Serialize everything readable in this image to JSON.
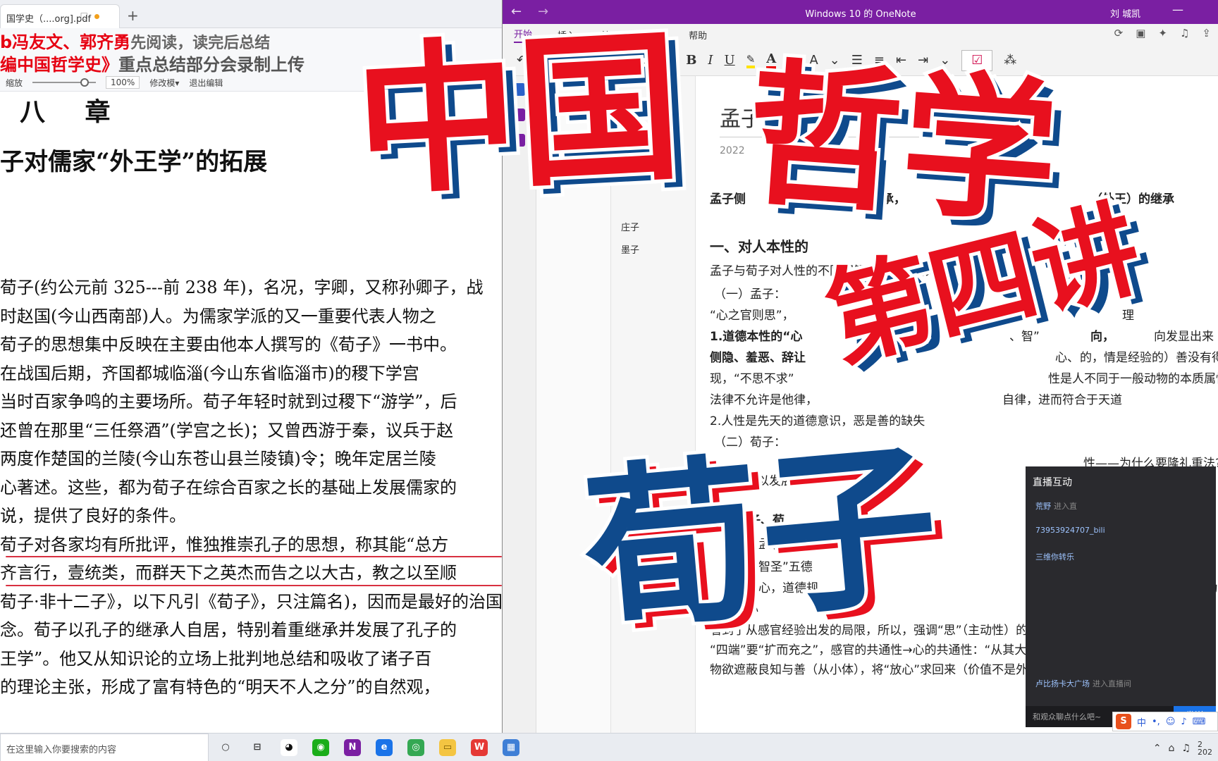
{
  "pdf": {
    "tab_label": "国学史（....org].pdf",
    "tab_close": "□",
    "newtab_icon": "+",
    "overlay_line1_red": "b冯友文",
    "overlay_line1_mid": "、郭齐勇",
    "overlay_line1_rest": "先阅读，读完后总结",
    "overlay_line2_red": "编中国哲学史》",
    "overlay_line2_rest": "重点总结部分会录制上传",
    "toolbar": {
      "zoom_label": "缩放",
      "zoom_value": "100%",
      "zoom_level": 0.75,
      "mode_label": "修改模▾",
      "exit_label": "退出编辑"
    },
    "chapter_heading": "八 章",
    "section_title": "子对儒家“外王学”的拓展",
    "body_lines": [
      "  荀子(约公元前 325---前 238 年)，名况，字卿，又称孙卿子，战",
      "时赵国(今山西南部)人。为儒家学派的又一重要代表人物之",
      "  荀子的思想集中反映在主要由他本人撰写的《荀子》一书中。",
      "  在战国后期，齐国都城临淄(今山东省临淄市)的稷下学宫",
      "当时百家争鸣的主要场所。荀子年轻时就到过稷下“游学”，后",
      "还曾在那里“三任祭酒”(学宫之长)；又曾西游于秦，议兵于赵",
      "两度作楚国的兰陵(今山东苍山县兰陵镇)令；晚年定居兰陵",
      "心著述。这些，都为荀子在综合百家之长的基础上发展儒家的",
      "说，提供了良好的条件。",
      "  荀子对各家均有所批评，惟独推崇孔子的思想，称其能“总方",
      "齐言行，壹统类，而群天下之英杰而告之以大古，教之以至顺",
      "荀子·非十二子》，以下凡引《荀子》，只注篇名)，因而是最好的治国",
      "念。荀子以孔子的继承人自居，特别着重继承并发展了孔子的",
      "王学”。他又从知识论的立场上批判地总结和吸收了诸子百",
      "的理论主张，形成了富有特色的“明天不人之分”的自然观，"
    ],
    "underlined_lines": [
      9,
      10
    ]
  },
  "onenote": {
    "app_title": "Windows 10 的 OneNote",
    "user_name": "刘 城凯",
    "nav_back": "←",
    "nav_forward": "→",
    "ribbon_tabs": [
      "开始",
      "插入",
      "绘图",
      "视图",
      "帮助"
    ],
    "font_name": "等线 YaH",
    "font_size": "11",
    "format_labels": {
      "bold": "B",
      "italic": "I",
      "underline": "U",
      "font_color": "A",
      "style": "A"
    },
    "sidebar_accents": [
      "#2a62c9",
      "#7a1fa2",
      "#7a1fa2"
    ],
    "pages": [
      "庄子",
      "墨子"
    ],
    "page_title": "孟子",
    "page_date": "2022",
    "content_lines": [
      {
        "text": "孟子侧",
        "bold": true
      },
      {
        "text": "的继承，",
        "bold": true
      },
      {
        "text": "（外王）的继承",
        "bold": true
      },
      {
        "text": "一、对人本性的",
        "bold": true,
        "size": 20
      },
      {
        "text": "孟子与荀子对人性的不同理解，仁来自何处",
        "bold": false
      },
      {
        "text": "（一）孟子：",
        "bold": false
      },
      {
        "text": "“心之官则思”，",
        "bold": false
      },
      {
        "text": "感官的",
        "bold": false
      },
      {
        "text": "理",
        "bold": false
      },
      {
        "text": "1.道德本性的“心",
        "bold": true,
        "blue_part": "1."
      },
      {
        "text": "、智”",
        "bold": false
      },
      {
        "text": "向，",
        "bold": true
      },
      {
        "text": "向发显出来",
        "bold": false
      },
      {
        "text": "侧隐、羞恶、辞让",
        "bold": true
      },
      {
        "text": "心、",
        "bold": false
      },
      {
        "text": "的，情是经验的）善没有得到恰当",
        "bold": false
      },
      {
        "text": "现，“不思不求”",
        "bold": false
      },
      {
        "text": "性是人不同于一般动物的本质属性",
        "bold": false
      },
      {
        "text": "法律不允许是他律，",
        "bold": false
      },
      {
        "text": "自律，进而符合于天道",
        "bold": false
      },
      {
        "text": "2.人性是先天的道德意识，恶是善的缺失",
        "bold": false
      },
      {
        "text": "（二）荀子：",
        "bold": false
      },
      {
        "text": "性——为什么要隆礼重法?",
        "bold": false
      },
      {
        "text": "可以发展出恶",
        "bold": false
      },
      {
        "text": "结果",
        "bold": false
      },
      {
        "text": "孟子、荀",
        "bold": true
      },
      {
        "text": "不同认识：",
        "bold": true
      },
      {
        "text": "（一）孟子",
        "bold": false
      },
      {
        "text": "仁义礼智圣”五德",
        "bold": false
      },
      {
        "text": "仁：人心，道德规",
        "bold": false
      },
      {
        "text": "义：人路，实现仁的道德行为的总称",
        "bold": false
      },
      {
        "text": "求放心",
        "bold": false
      },
      {
        "text": "看到了从感官经验出发的局限，所以，强调“思”（主动性）的作用",
        "bold": false
      },
      {
        "text": "“四端”要“扩而充之”，感官的共通性→心的共通性：“从其大体为大人、从其小体为",
        "bold": false
      },
      {
        "text": "物欲遮蔽良知与善（从小体），将“放心”求回来（价值不是外在",
        "bold": false
      }
    ]
  },
  "live_chat": {
    "header": "直播互动",
    "messages": [
      {
        "user": "荒野",
        "text": "进入直"
      },
      {
        "user": "73953924707_bili",
        "text": ""
      },
      {
        "user": "三维你转乐",
        "text": ""
      },
      {
        "user": "卢比扬卡大广场",
        "text": "进入直播间"
      }
    ],
    "input_placeholder": "和观众聊点什么吧~",
    "send_label": "发送"
  },
  "overlay_titles": {
    "main": "中国哲学",
    "main_a": "中国",
    "main_b": "哲学",
    "lecture": "第四讲",
    "subject": "荀子"
  },
  "taskbar": {
    "search_placeholder": "在这里输入你要搜索的内容",
    "ime_label": "中",
    "ime_logo": "S",
    "clock_top": "2",
    "clock_bottom": "202"
  },
  "colors": {
    "onenote_purple": "#7a1fa2",
    "title_red": "#e8101e",
    "title_blue": "#0f4a8c",
    "overlay_red": "#e60012"
  }
}
